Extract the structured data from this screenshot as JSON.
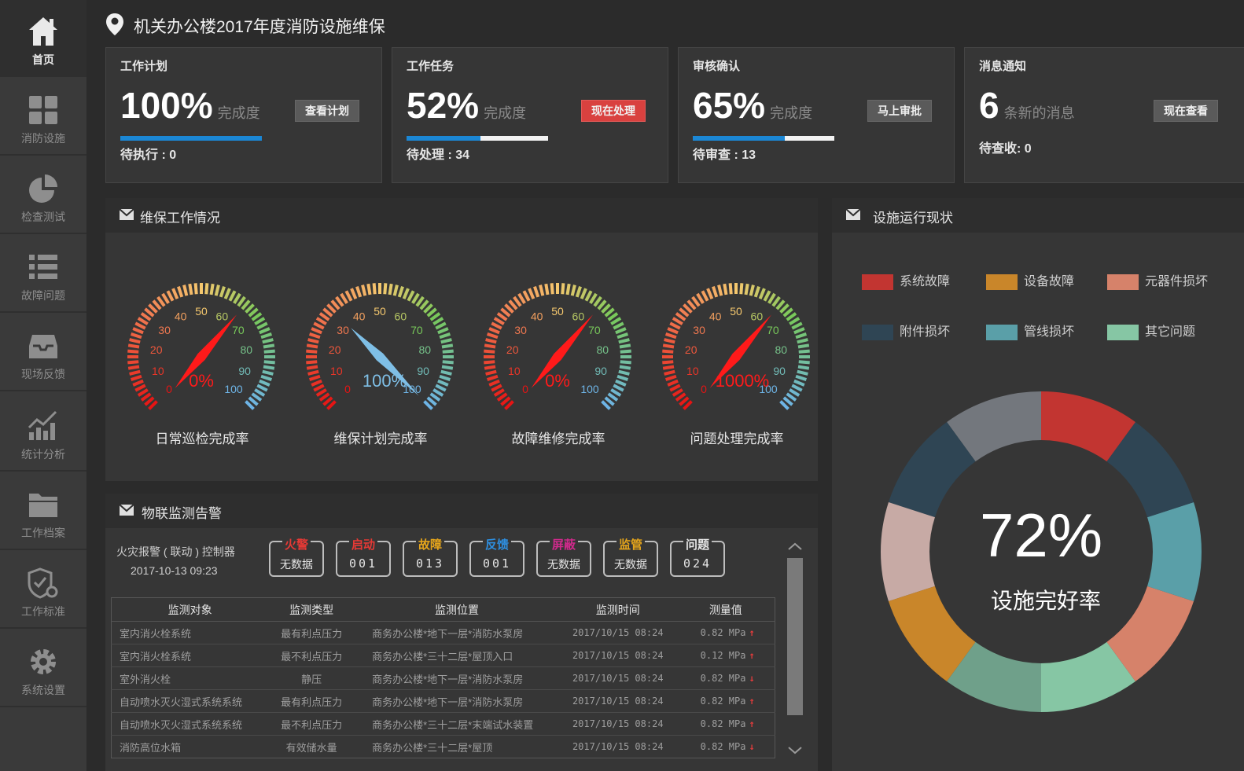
{
  "sidebar": {
    "items": [
      {
        "label": "首页",
        "icon": "home-icon",
        "active": true
      },
      {
        "label": "消防设施",
        "icon": "grid-icon"
      },
      {
        "label": "检查测试",
        "icon": "pie-icon"
      },
      {
        "label": "故障问题",
        "icon": "list-icon"
      },
      {
        "label": "现场反馈",
        "icon": "inbox-icon"
      },
      {
        "label": "统计分析",
        "icon": "chart-icon"
      },
      {
        "label": "工作档案",
        "icon": "folder-icon"
      },
      {
        "label": "工作标准",
        "icon": "shield-gear-icon"
      },
      {
        "label": "系统设置",
        "icon": "gear-icon"
      }
    ]
  },
  "header": {
    "title": "机关办公楼2017年度消防设施维保",
    "icon": "location-pin-icon"
  },
  "cards": [
    {
      "title": "工作计划",
      "value": "100%",
      "unit": "完成度",
      "button": "查看计划",
      "button_style": "gray",
      "progress": 1.0,
      "sub": "待执行 : 0"
    },
    {
      "title": "工作任务",
      "value": "52%",
      "unit": "完成度",
      "button": "现在处理",
      "button_style": "red",
      "progress": 0.52,
      "sub": "待处理 : 34"
    },
    {
      "title": "审核确认",
      "value": "65%",
      "unit": "完成度",
      "button": "马上审批",
      "button_style": "gray",
      "progress": 0.65,
      "sub": "待审查 : 13"
    },
    {
      "title": "消息通知",
      "value": "6",
      "unit": "条新的消息",
      "button": "现在查看",
      "button_style": "gray",
      "progress": null,
      "sub": "待查收: 0"
    }
  ],
  "maintenance": {
    "title": "维保工作情况",
    "gauges": [
      {
        "label": "日常巡检完成率",
        "value_text": "0%",
        "value": 0,
        "needle_color": "#ff1a1a"
      },
      {
        "label": "维保计划完成率",
        "value_text": "100%",
        "value": 100,
        "needle_color": "#7fbfe6"
      },
      {
        "label": "故障维修完成率",
        "value_text": "0%",
        "value": 0,
        "needle_color": "#ff1a1a"
      },
      {
        "label": "问题处理完成率",
        "value_text": "1000%",
        "value": 0,
        "needle_color": "#ff1a1a"
      }
    ],
    "ticks": [
      "0",
      "10",
      "20",
      "30",
      "40",
      "50",
      "60",
      "70",
      "80",
      "90",
      "100"
    ]
  },
  "facility": {
    "title": "设施运行现状",
    "legend": [
      {
        "label": "系统故障",
        "color": "#c23531"
      },
      {
        "label": "设备故障",
        "color": "#c9862a"
      },
      {
        "label": "元器件损坏",
        "color": "#d6826a"
      },
      {
        "label": "附件损坏",
        "color": "#2f4554"
      },
      {
        "label": "管线损坏",
        "color": "#5a9fa8"
      },
      {
        "label": "其它问题",
        "color": "#86c6a4"
      }
    ],
    "center_value": "72%",
    "center_label": "设施完好率"
  },
  "monitor": {
    "title": "物联监测告警",
    "controller": "火灾报警 ( 联动 ) 控制器",
    "time": "2017-10-13  09:23",
    "counters": [
      {
        "label": "火警",
        "value": "无数据",
        "color": "#e53935"
      },
      {
        "label": "启动",
        "value": "001",
        "color": "#e53935"
      },
      {
        "label": "故障",
        "value": "013",
        "color": "#e5a51b"
      },
      {
        "label": "反馈",
        "value": "001",
        "color": "#2e8fe0"
      },
      {
        "label": "屏蔽",
        "value": "无数据",
        "color": "#d02a8c"
      },
      {
        "label": "监管",
        "value": "无数据",
        "color": "#e5a51b"
      },
      {
        "label": "问题",
        "value": "024",
        "color": "#e6e6e6"
      }
    ],
    "columns": [
      "监测对象",
      "监测类型",
      "监测位置",
      "监测时间",
      "测量值"
    ],
    "rows": [
      {
        "object": "室内消火栓系统",
        "type": "最有利点压力",
        "location": "商务办公楼*地下一层*消防水泵房",
        "time": "2017/10/15 08:24",
        "value": "0.82 MPa",
        "trend": "up"
      },
      {
        "object": "室内消火栓系统",
        "type": "最不利点压力",
        "location": "商务办公楼*三十二层*屋顶入口",
        "time": "2017/10/15 08:24",
        "value": "0.12 MPa",
        "trend": "up"
      },
      {
        "object": "室外消火栓",
        "type": "静压",
        "location": "商务办公楼*地下一层*消防水泵房",
        "time": "2017/10/15 08:24",
        "value": "0.82 MPa",
        "trend": "down"
      },
      {
        "object": "自动喷水灭火湿式系统系统",
        "type": "最有利点压力",
        "location": "商务办公楼*地下一层*消防水泵房",
        "time": "2017/10/15 08:24",
        "value": "0.82 MPa",
        "trend": "up"
      },
      {
        "object": "自动喷水灭火湿式系统系统",
        "type": "最不利点压力",
        "location": "商务办公楼*三十二层*末端试水装置",
        "time": "2017/10/15 08:24",
        "value": "0.82 MPa",
        "trend": "up"
      },
      {
        "object": "消防高位水箱",
        "type": "有效储水量",
        "location": "商务办公楼*三十二层*屋顶",
        "time": "2017/10/15 08:24",
        "value": "0.82 MPa",
        "trend": "down"
      }
    ]
  }
}
